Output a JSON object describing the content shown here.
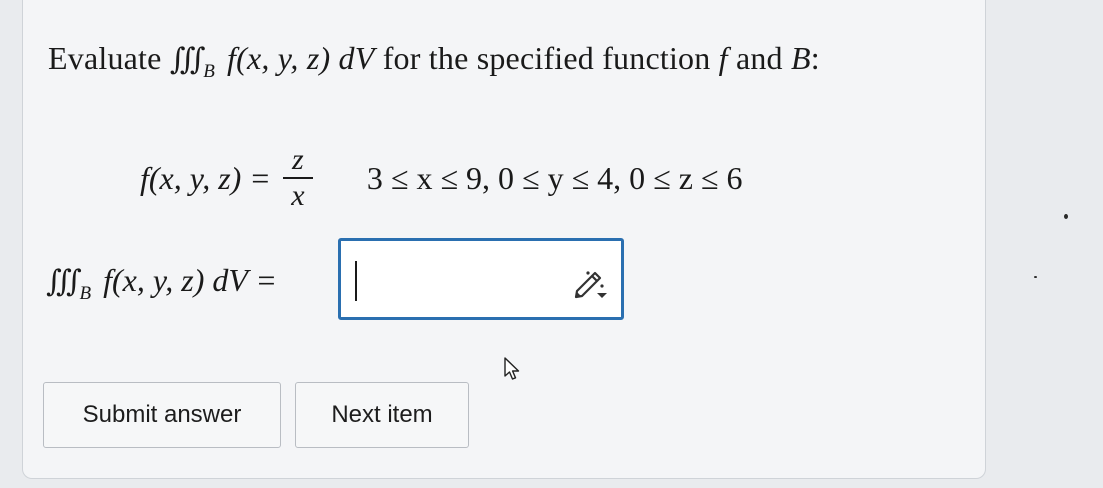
{
  "prompt": {
    "lead": "Evaluate",
    "integral": "∭",
    "region_sub": "B",
    "integrand": "f(x, y, z) dV",
    "tail": "for the specified function",
    "f_symbol": "f",
    "and_text": "and",
    "region": "B",
    "colon": ":"
  },
  "function": {
    "lhs": "f(x, y, z) =",
    "numerator": "z",
    "denominator": "x",
    "bounds": "3 ≤ x ≤ 9, 0 ≤ y ≤ 4, 0 ≤ z ≤ 6"
  },
  "answer": {
    "integral": "∭",
    "region_sub": "B",
    "expr": "f(x, y, z) dV =",
    "value": ""
  },
  "buttons": {
    "submit_label": "Submit answer",
    "next_label": "Next item"
  },
  "colors": {
    "accent": "#2a6fb0",
    "page_bg": "#e9ebee",
    "card_bg": "#f4f5f7"
  },
  "icons": {
    "answer_tool": "pencil-dropdown-icon",
    "pointer": "mouse-pointer-icon"
  }
}
